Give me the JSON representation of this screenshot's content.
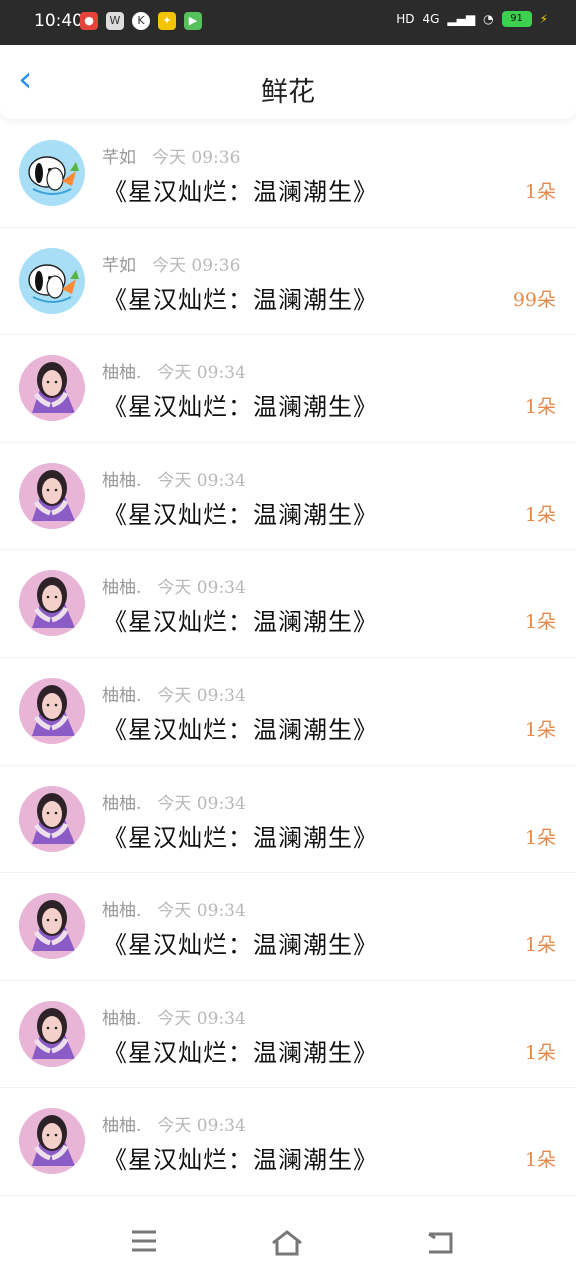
{
  "status": {
    "time": "10:40",
    "network": "4G",
    "wifi": "wifi-icon",
    "battery": "91"
  },
  "header": {
    "title": "鲜花"
  },
  "records": [
    {
      "name": "芊如",
      "time": "今天 09:36",
      "book": "《星汉灿烂：温澜潮生》",
      "count": "1朵",
      "avatar": "pochacco"
    },
    {
      "name": "芊如",
      "time": "今天 09:36",
      "book": "《星汉灿烂：温澜潮生》",
      "count": "99朵",
      "avatar": "pochacco"
    },
    {
      "name": "柚柚.",
      "time": "今天 09:34",
      "book": "《星汉灿烂：温澜潮生》",
      "count": "1朵",
      "avatar": "girl"
    },
    {
      "name": "柚柚.",
      "time": "今天 09:34",
      "book": "《星汉灿烂：温澜潮生》",
      "count": "1朵",
      "avatar": "girl"
    },
    {
      "name": "柚柚.",
      "time": "今天 09:34",
      "book": "《星汉灿烂：温澜潮生》",
      "count": "1朵",
      "avatar": "girl"
    },
    {
      "name": "柚柚.",
      "time": "今天 09:34",
      "book": "《星汉灿烂：温澜潮生》",
      "count": "1朵",
      "avatar": "girl"
    },
    {
      "name": "柚柚.",
      "time": "今天 09:34",
      "book": "《星汉灿烂：温澜潮生》",
      "count": "1朵",
      "avatar": "girl"
    },
    {
      "name": "柚柚.",
      "time": "今天 09:34",
      "book": "《星汉灿烂：温澜潮生》",
      "count": "1朵",
      "avatar": "girl"
    },
    {
      "name": "柚柚.",
      "time": "今天 09:34",
      "book": "《星汉灿烂：温澜潮生》",
      "count": "1朵",
      "avatar": "girl"
    },
    {
      "name": "柚柚.",
      "time": "今天 09:34",
      "book": "《星汉灿烂：温澜潮生》",
      "count": "1朵",
      "avatar": "girl"
    }
  ],
  "nav": {
    "menu": "menu-icon",
    "home": "home-icon",
    "back": "back-icon"
  }
}
